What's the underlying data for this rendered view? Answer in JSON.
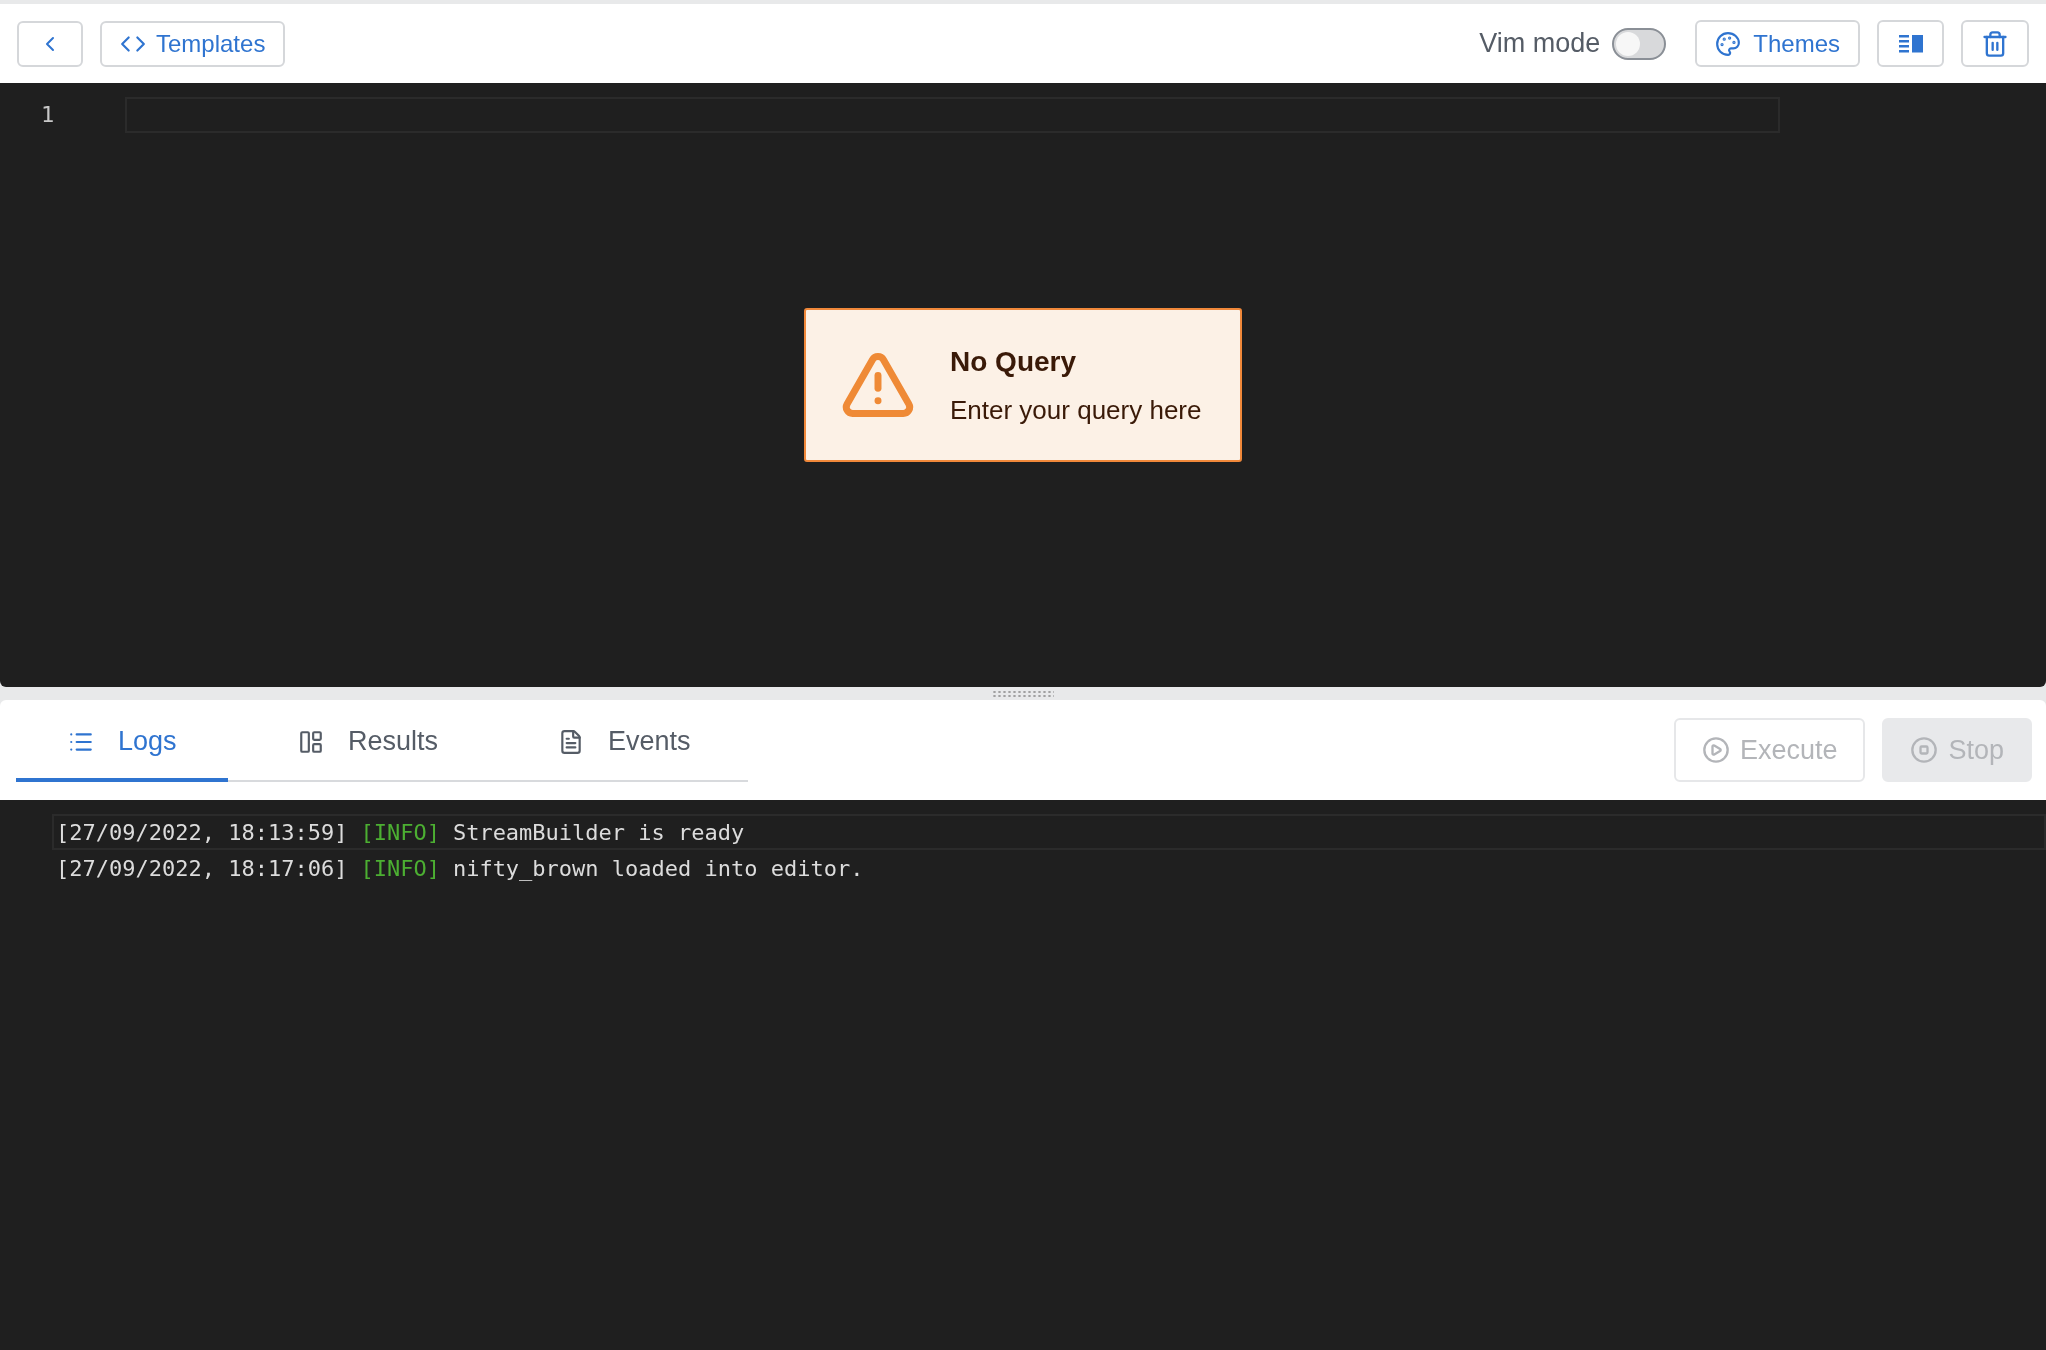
{
  "toolbar": {
    "templates_button": "Templates",
    "vim_mode": {
      "label": "Vim mode",
      "on": false
    },
    "themes_button": "Themes"
  },
  "editor": {
    "line_numbers": [
      "1"
    ],
    "alert": {
      "title": "No Query",
      "message": "Enter your query here"
    }
  },
  "tabs": [
    {
      "label": "Logs",
      "selected": true,
      "kind": "logs"
    },
    {
      "label": "Results",
      "selected": false,
      "kind": "results"
    },
    {
      "label": "Events",
      "selected": false,
      "kind": "events"
    }
  ],
  "actions": [
    {
      "label": "Execute",
      "kind": "execute",
      "disabled": true
    },
    {
      "label": "Stop",
      "kind": "stop",
      "disabled": true
    }
  ],
  "logs": [
    {
      "timestamp": "[27/09/2022, 18:13:59]",
      "level": "[INFO]",
      "kind": "info",
      "message": "StreamBuilder is ready",
      "selected": true
    },
    {
      "timestamp": "[27/09/2022, 18:17:06]",
      "level": "[INFO]",
      "kind": "info",
      "message": "nifty_brown loaded into editor.",
      "selected": false
    }
  ]
}
